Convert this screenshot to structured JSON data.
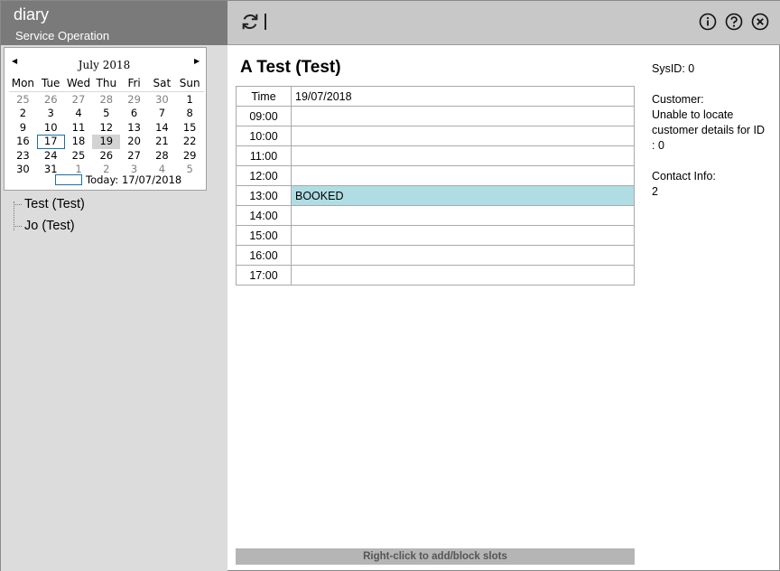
{
  "app": {
    "title": "diary",
    "subtitle": "Service Operation"
  },
  "calendar": {
    "month_label": "July 2018",
    "prev_icon": "left-triangle",
    "next_icon": "right-triangle",
    "weekdays": [
      "Mon",
      "Tue",
      "Wed",
      "Thu",
      "Fri",
      "Sat",
      "Sun"
    ],
    "weeks": [
      [
        {
          "d": "25",
          "other": true
        },
        {
          "d": "26",
          "other": true
        },
        {
          "d": "27",
          "other": true
        },
        {
          "d": "28",
          "other": true
        },
        {
          "d": "29",
          "other": true
        },
        {
          "d": "30",
          "other": true
        },
        {
          "d": "1"
        }
      ],
      [
        {
          "d": "2"
        },
        {
          "d": "3"
        },
        {
          "d": "4"
        },
        {
          "d": "5"
        },
        {
          "d": "6"
        },
        {
          "d": "7"
        },
        {
          "d": "8"
        }
      ],
      [
        {
          "d": "9"
        },
        {
          "d": "10"
        },
        {
          "d": "11"
        },
        {
          "d": "12"
        },
        {
          "d": "13"
        },
        {
          "d": "14"
        },
        {
          "d": "15"
        }
      ],
      [
        {
          "d": "16"
        },
        {
          "d": "17",
          "today": true
        },
        {
          "d": "18"
        },
        {
          "d": "19",
          "selected": true
        },
        {
          "d": "20"
        },
        {
          "d": "21"
        },
        {
          "d": "22"
        }
      ],
      [
        {
          "d": "23"
        },
        {
          "d": "24"
        },
        {
          "d": "25"
        },
        {
          "d": "26"
        },
        {
          "d": "27"
        },
        {
          "d": "28"
        },
        {
          "d": "29"
        }
      ],
      [
        {
          "d": "30"
        },
        {
          "d": "31"
        },
        {
          "d": "1",
          "other": true
        },
        {
          "d": "2",
          "other": true
        },
        {
          "d": "3",
          "other": true
        },
        {
          "d": "4",
          "other": true
        },
        {
          "d": "5",
          "other": true
        }
      ]
    ],
    "today_label": "Today: 17/07/2018"
  },
  "tree": {
    "items": [
      "Test (Test)",
      "Jo (Test)"
    ]
  },
  "toolbar": {
    "refresh_icon": "refresh-icon",
    "info_icon": "info-icon",
    "help_icon": "help-icon",
    "close_icon": "close-icon"
  },
  "main": {
    "title": "A Test (Test)",
    "table": {
      "header": {
        "time": "Time",
        "date": "19/07/2018"
      },
      "rows": [
        {
          "time": "09:00",
          "slot": ""
        },
        {
          "time": "10:00",
          "slot": ""
        },
        {
          "time": "11:00",
          "slot": ""
        },
        {
          "time": "12:00",
          "slot": ""
        },
        {
          "time": "13:00",
          "slot": "BOOKED",
          "booked": true
        },
        {
          "time": "14:00",
          "slot": ""
        },
        {
          "time": "15:00",
          "slot": ""
        },
        {
          "time": "16:00",
          "slot": ""
        },
        {
          "time": "17:00",
          "slot": ""
        }
      ]
    },
    "hint": "Right-click to add/block slots"
  },
  "info": {
    "sysid": "SysID: 0",
    "customer_label": "Customer:",
    "customer_text": "Unable to locate customer details for ID : 0",
    "contact_label": "Contact Info:",
    "contact_value": "2"
  },
  "colors": {
    "booked": "#b0dde4",
    "header_left": "#7a7a7a",
    "header_top": "#c8c8c8",
    "today_outline": "#1c6ea4"
  }
}
